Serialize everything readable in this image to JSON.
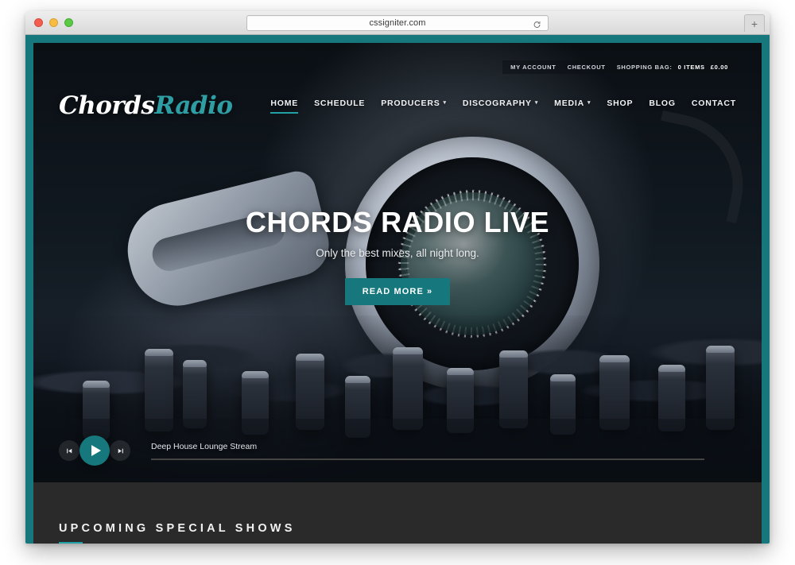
{
  "browser": {
    "url": "cssigniter.com",
    "reload_icon": "reload-icon",
    "new_tab_label": "+",
    "traffic_lights": [
      "close",
      "minimize",
      "maximize"
    ]
  },
  "topbar": {
    "my_account": "MY ACCOUNT",
    "checkout": "CHECKOUT",
    "shopping_bag_label": "SHOPPING BAG:",
    "items_count": "0 ITEMS",
    "total": "£0.00"
  },
  "header": {
    "logo_part1": "Chords",
    "logo_part2": "Radio",
    "nav": [
      {
        "label": "HOME",
        "active": true,
        "has_caret": false
      },
      {
        "label": "SCHEDULE",
        "active": false,
        "has_caret": false
      },
      {
        "label": "PRODUCERS",
        "active": false,
        "has_caret": true
      },
      {
        "label": "DISCOGRAPHY",
        "active": false,
        "has_caret": true
      },
      {
        "label": "MEDIA",
        "active": false,
        "has_caret": true
      },
      {
        "label": "SHOP",
        "active": false,
        "has_caret": false
      },
      {
        "label": "BLOG",
        "active": false,
        "has_caret": false
      },
      {
        "label": "CONTACT",
        "active": false,
        "has_caret": false
      }
    ],
    "caret_glyph": "▾"
  },
  "hero": {
    "title": "CHORDS RADIO LIVE",
    "subtitle": "Only the best mixes, all night long.",
    "button_label": "READ MORE »",
    "image_description": "dj-headphones-mixer-photo"
  },
  "player": {
    "prev_icon": "skip-previous-icon",
    "play_icon": "play-icon",
    "next_icon": "skip-next-icon",
    "track_title": "Deep House Lounge Stream",
    "progress_percent": 0
  },
  "section": {
    "title": "UPCOMING SPECIAL SHOWS"
  },
  "colors": {
    "accent_teal": "#16787c",
    "accent_teal_light": "#21a0a5",
    "logo_teal": "#2f9ea4",
    "section_bg": "#2a2a2a",
    "frame_teal": "#16787c"
  }
}
